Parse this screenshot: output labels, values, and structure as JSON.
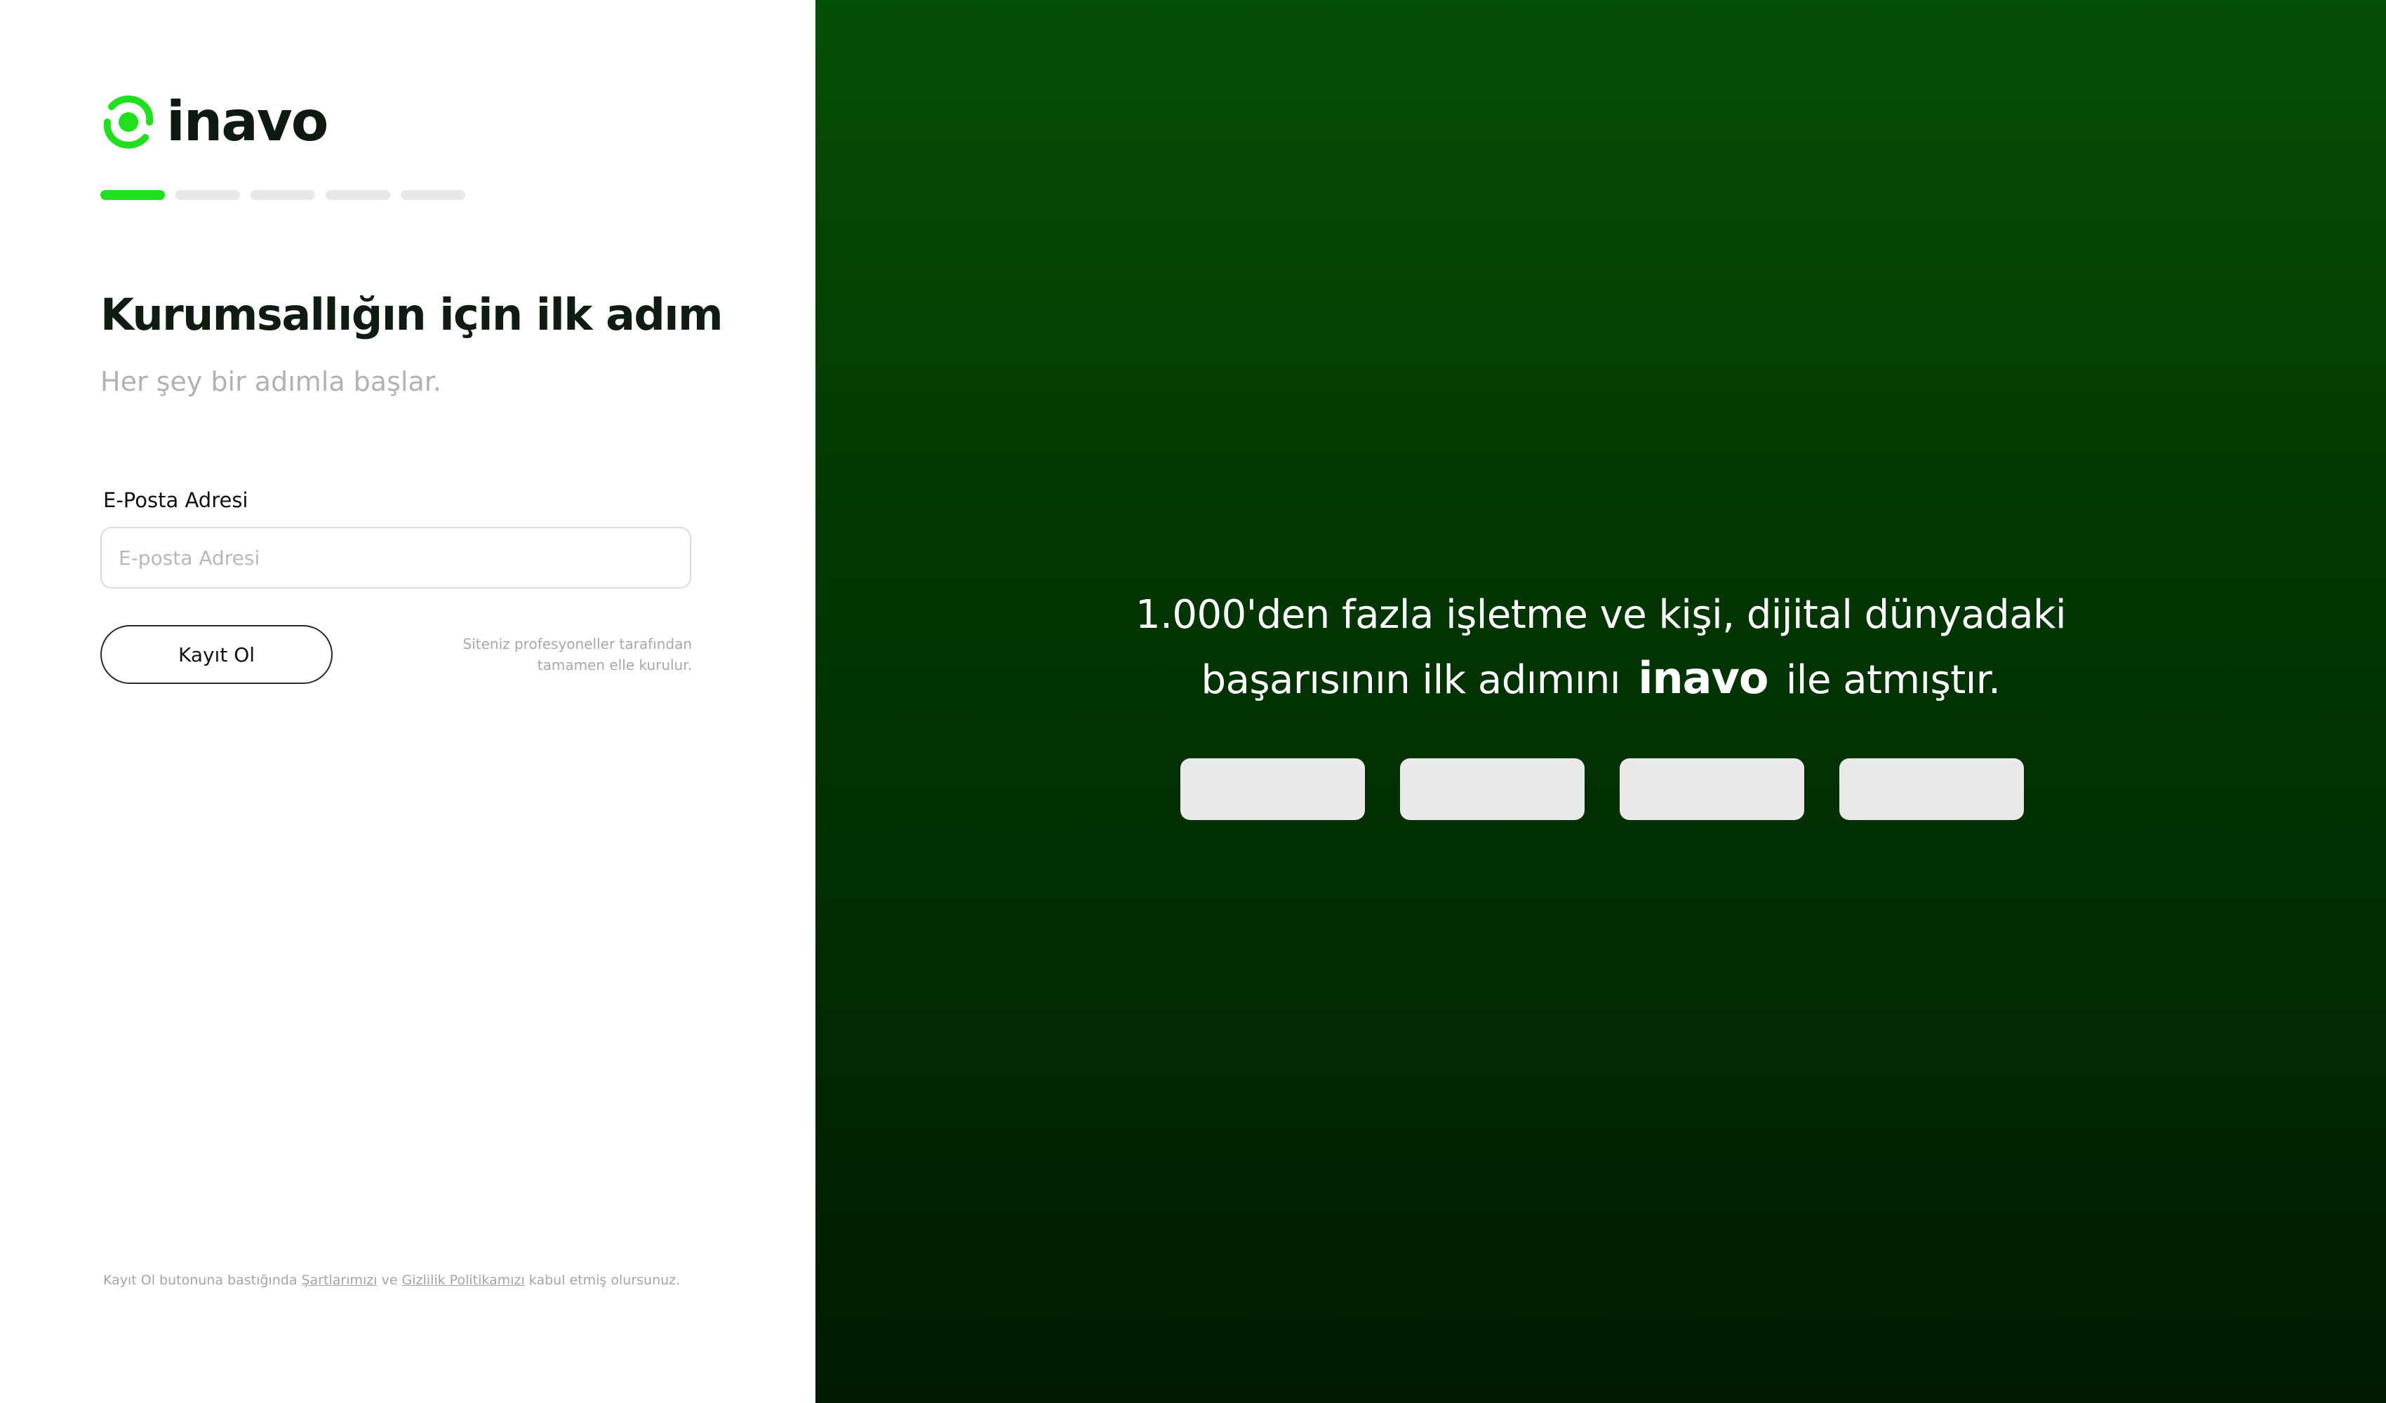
{
  "brand": {
    "name": "inavo",
    "accent_color": "#1fe01c",
    "logo_icon": "inavo-logo-icon"
  },
  "progress": {
    "total_steps": 5,
    "current_step": 1
  },
  "form": {
    "title": "Kurumsallığın için ilk adım",
    "subtitle": "Her şey bir adımla başlar.",
    "email_label": "E-Posta Adresi",
    "email_placeholder": "E-posta Adresi",
    "email_value": "",
    "register_button": "Kayıt Ol",
    "pro_note_line1": "Siteniz profesyoneller tarafından",
    "pro_note_line2": "tamamen elle kurulur."
  },
  "footer": {
    "before": "Kayıt Ol butonuna bastığında ",
    "terms_link": "Şartlarımızı",
    "middle": " ve ",
    "privacy_link": "Gizlilik Politikamızı",
    "after": " kabul etmiş olursunuz."
  },
  "promo": {
    "line1": "1.000'den fazla işletme ve kişi, dijital dünyadaki",
    "line2_before": "başarısının ilk adımını",
    "line2_brand": "inavo",
    "line2_after": "ile atmıştır.",
    "background_top": "#064f06",
    "background_bottom": "#021a03",
    "logo_placeholders": 4
  }
}
